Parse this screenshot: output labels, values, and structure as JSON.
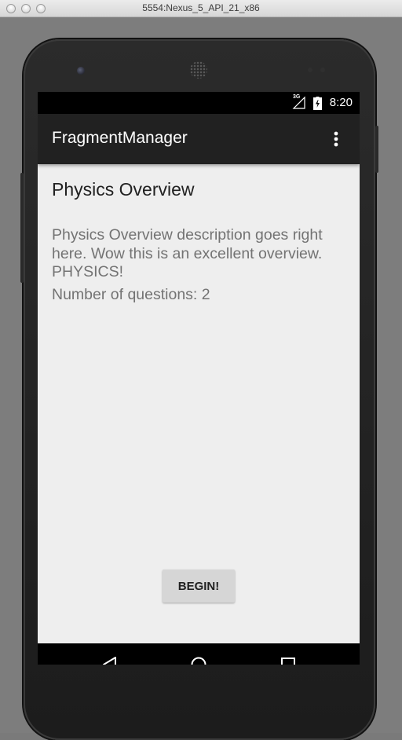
{
  "window": {
    "title": "5554:Nexus_5_API_21_x86"
  },
  "statusbar": {
    "network": "3G",
    "time": "8:20"
  },
  "appbar": {
    "title": "FragmentManager",
    "overflow_icon": "more-vert-icon"
  },
  "content": {
    "title": "Physics Overview",
    "description": "Physics Overview description goes right here. Wow this is an excellent overview. PHYSICS!",
    "question_count": "Number of questions: 2",
    "begin_label": "BEGIN!"
  },
  "navbar": {
    "back_icon": "back-icon",
    "home_icon": "home-icon",
    "recents_icon": "recents-icon"
  },
  "colors": {
    "appbar": "#212121",
    "background": "#eeeeee",
    "button": "#d6d6d6",
    "body_text": "#737373"
  }
}
